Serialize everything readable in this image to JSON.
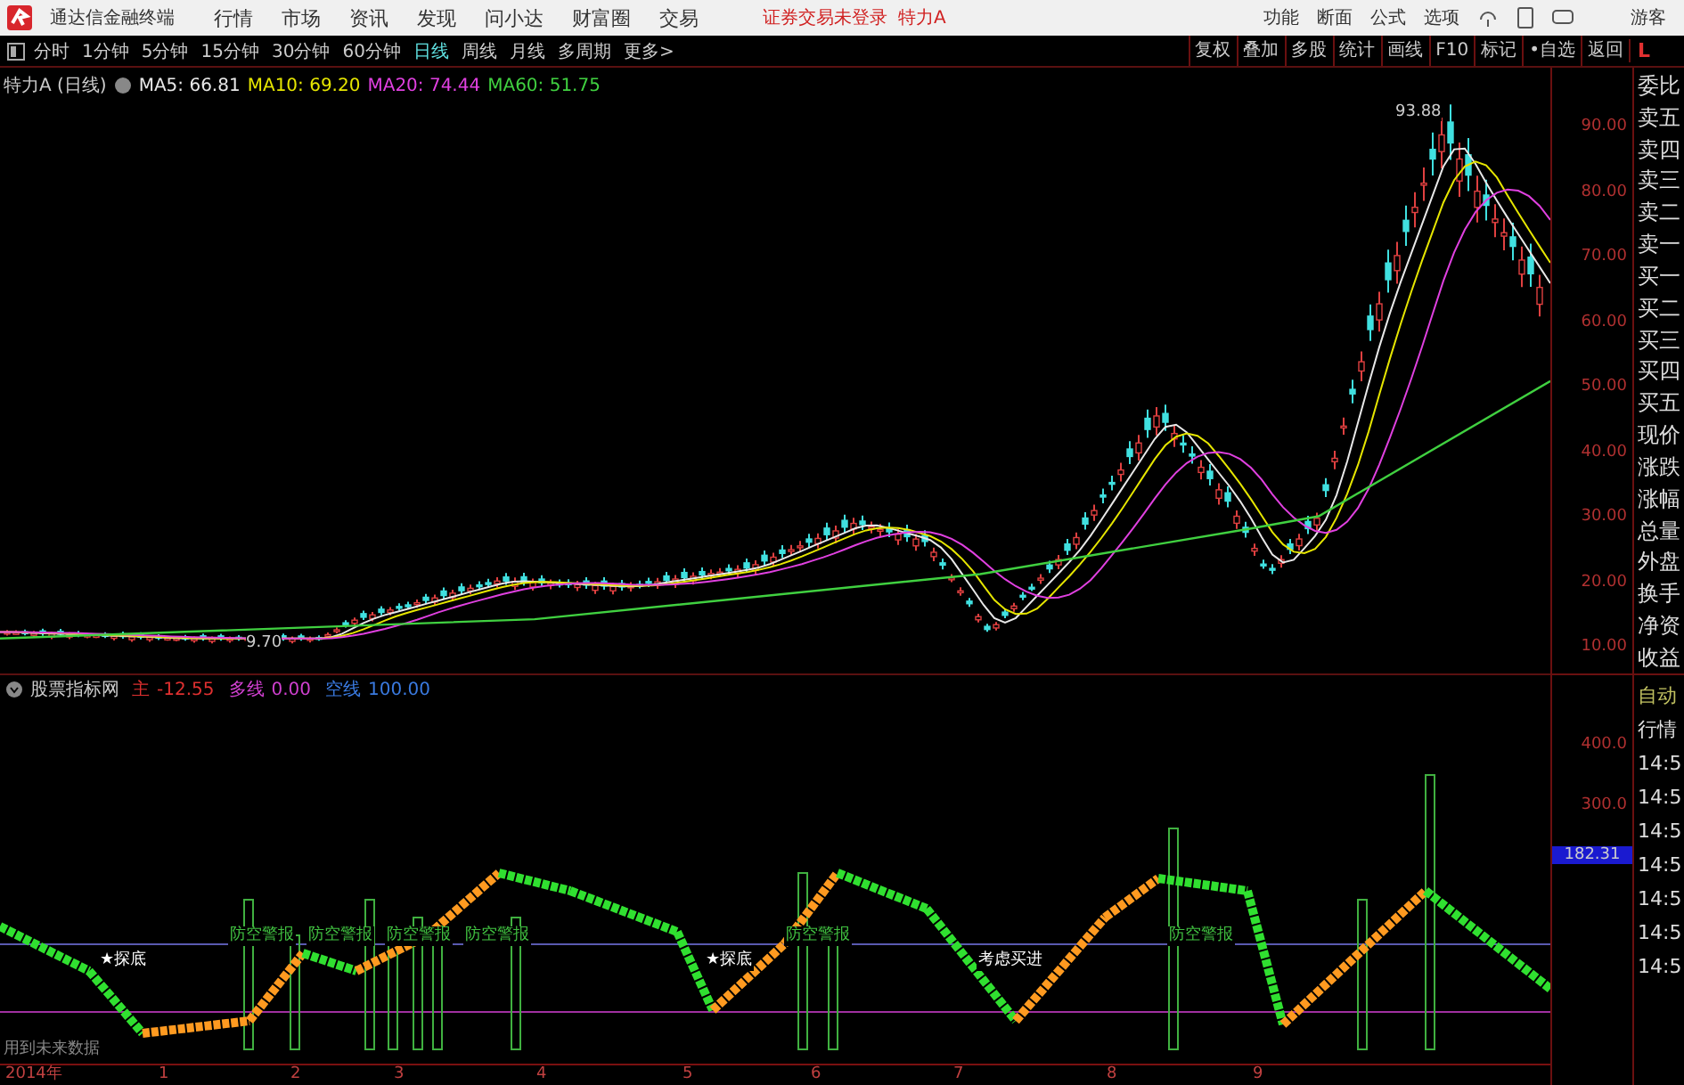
{
  "title_bar": {
    "app_name": "通达信金融终端",
    "menus": [
      "行情",
      "市场",
      "资讯",
      "发现",
      "问小达",
      "财富圈",
      "交易"
    ],
    "login_status": "证券交易未登录",
    "stock_name": "特力A",
    "tools": [
      "功能",
      "断面",
      "公式",
      "选项"
    ],
    "user": "游客"
  },
  "period_tabs": [
    {
      "label": "分时",
      "selected": false
    },
    {
      "label": "1分钟",
      "selected": false
    },
    {
      "label": "5分钟",
      "selected": false
    },
    {
      "label": "15分钟",
      "selected": false
    },
    {
      "label": "30分钟",
      "selected": false
    },
    {
      "label": "60分钟",
      "selected": false
    },
    {
      "label": "日线",
      "selected": true
    },
    {
      "label": "周线",
      "selected": false
    },
    {
      "label": "月线",
      "selected": false
    },
    {
      "label": "多周期",
      "selected": false
    },
    {
      "label": "更多>",
      "selected": false
    }
  ],
  "chart_tools": [
    "复权",
    "叠加",
    "多股",
    "统计",
    "画线",
    "F10",
    "标记",
    "•自选",
    "返回"
  ],
  "layout_toggle": "L",
  "price_chart": {
    "title": "特力A (日线)",
    "ma": [
      {
        "label": "MA5: 66.81",
        "color": "#e8e8e8"
      },
      {
        "label": "MA10: 69.20",
        "color": "#e6e600"
      },
      {
        "label": "MA20: 74.44",
        "color": "#e040e0"
      },
      {
        "label": "MA60: 51.75",
        "color": "#40d040"
      }
    ],
    "high_label": "93.88",
    "low_label": "9.70",
    "axis": [
      "90.00",
      "80.00",
      "70.00",
      "60.00",
      "50.00",
      "40.00",
      "30.00",
      "20.00",
      "10.00"
    ]
  },
  "side_panel": {
    "items": [
      "委比",
      "卖五",
      "卖四",
      "卖三",
      "卖二",
      "卖一",
      "买一",
      "买二",
      "买三",
      "买四",
      "买五",
      "现价",
      "涨跌",
      "涨幅",
      "总量",
      "外盘",
      "换手",
      "净资",
      "收益"
    ],
    "bottom": [
      "自动",
      "行情",
      "14:5",
      "14:5",
      "14:5",
      "14:5",
      "14:5",
      "14:5",
      "14:5"
    ]
  },
  "indicator": {
    "name": "股票指标网",
    "values": [
      {
        "label": "主",
        "value": "-12.55",
        "color": "#e03030"
      },
      {
        "label": "多线",
        "value": "0.00",
        "color": "#d040d0"
      },
      {
        "label": "空线",
        "value": "100.00",
        "color": "#3a7ae0"
      }
    ],
    "axis": [
      "400.0",
      "300.0"
    ],
    "current": "182.31",
    "signals": [
      {
        "text": "★探底",
        "kind": "bottom"
      },
      {
        "text": "防空警报",
        "kind": "alert"
      },
      {
        "text": "防空警报",
        "kind": "alert"
      },
      {
        "text": "防空警报",
        "kind": "alert"
      },
      {
        "text": "防空警报",
        "kind": "alert"
      },
      {
        "text": "★探底",
        "kind": "bottom"
      },
      {
        "text": "防空警报",
        "kind": "alert"
      },
      {
        "text": "考虑买进",
        "kind": "buy"
      },
      {
        "text": "防空警报",
        "kind": "alert"
      }
    ],
    "note": "用到未来数据"
  },
  "x_axis": [
    "2014年",
    "1",
    "2",
    "3",
    "4",
    "5",
    "6",
    "7",
    "8",
    "9"
  ]
}
